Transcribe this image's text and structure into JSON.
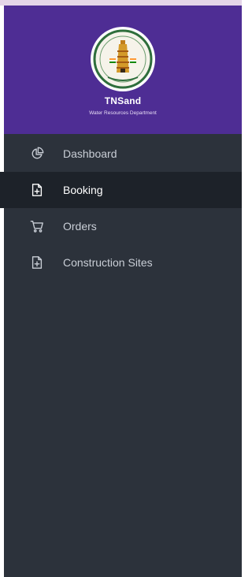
{
  "brand": {
    "title": "TNSand",
    "subtitle": "Water Resources Department",
    "logo": "tamil-nadu-emblem"
  },
  "nav": {
    "items": [
      {
        "label": "Dashboard",
        "icon": "pie-chart-icon",
        "active": false
      },
      {
        "label": "Booking",
        "icon": "file-plus-icon",
        "active": true
      },
      {
        "label": "Orders",
        "icon": "cart-icon",
        "active": false
      },
      {
        "label": "Construction Sites",
        "icon": "file-plus-icon",
        "active": false
      }
    ]
  },
  "colors": {
    "brand_bg": "#4e2d94",
    "sidebar_bg": "#2c323b",
    "active_bg": "#1d2229"
  }
}
